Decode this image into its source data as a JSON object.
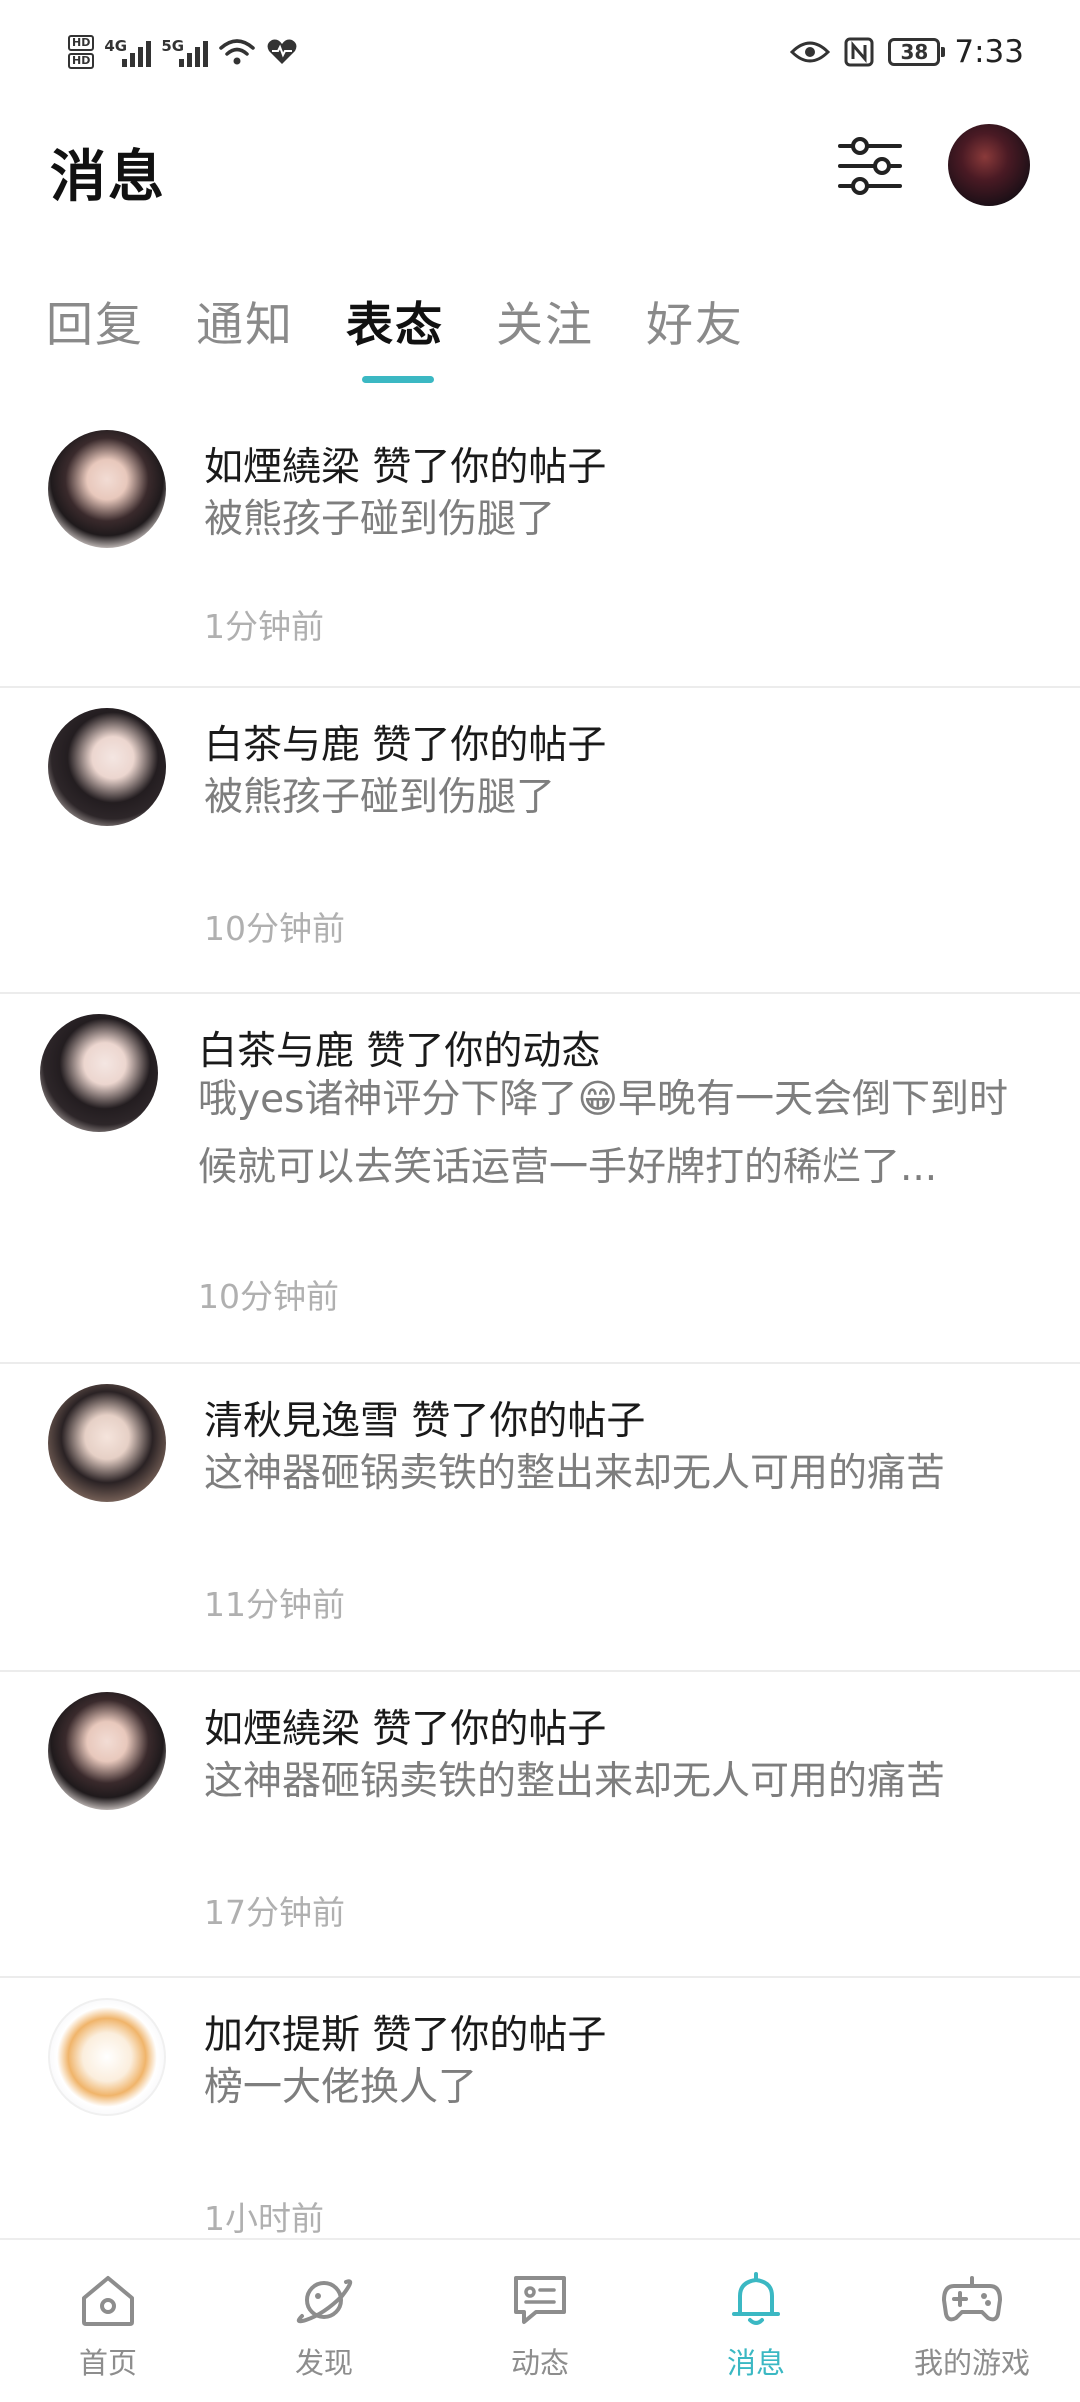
{
  "status_bar": {
    "hd1": "HD",
    "hd2": "HD",
    "net1": "4G",
    "net2": "5G",
    "battery": "38",
    "time": "7:33"
  },
  "header": {
    "title": "消息"
  },
  "tabs": [
    {
      "label": "回复"
    },
    {
      "label": "通知"
    },
    {
      "label": "表态"
    },
    {
      "label": "关注"
    },
    {
      "label": "好友"
    }
  ],
  "active_tab": "表态",
  "notifications": [
    {
      "name": "如煙繞梁",
      "action": "赞了你的帖子",
      "content": "被熊孩子碰到伤腿了",
      "time": "1分钟前"
    },
    {
      "name": "白茶与鹿",
      "action": "赞了你的帖子",
      "content": "被熊孩子碰到伤腿了",
      "time": "10分钟前"
    },
    {
      "name": "白茶与鹿",
      "action": "赞了你的动态",
      "content": "哦yes诸神评分下降了😁早晚有一天会倒下到时候就可以去笑话运营一手好牌打的稀烂了...",
      "time": "10分钟前"
    },
    {
      "name": "清秋見逸雪",
      "action": "赞了你的帖子",
      "content": "这神器砸锅卖铁的整出来却无人可用的痛苦",
      "time": "11分钟前"
    },
    {
      "name": "如煙繞梁",
      "action": "赞了你的帖子",
      "content": "这神器砸锅卖铁的整出来却无人可用的痛苦",
      "time": "17分钟前"
    },
    {
      "name": "加尔提斯",
      "action": "赞了你的帖子",
      "content": "榜一大佬换人了",
      "time": "1小时前"
    }
  ],
  "bottom_nav": [
    {
      "label": "首页",
      "icon": "home-icon"
    },
    {
      "label": "发现",
      "icon": "planet-icon"
    },
    {
      "label": "动态",
      "icon": "chat-icon"
    },
    {
      "label": "消息",
      "icon": "bell-icon"
    },
    {
      "label": "我的游戏",
      "icon": "gamepad-icon"
    }
  ],
  "colors": {
    "accent": "#3bb8c3",
    "text_primary": "#1a1a1a",
    "text_secondary": "#7e7e7e",
    "text_muted": "#b0b0b0"
  }
}
